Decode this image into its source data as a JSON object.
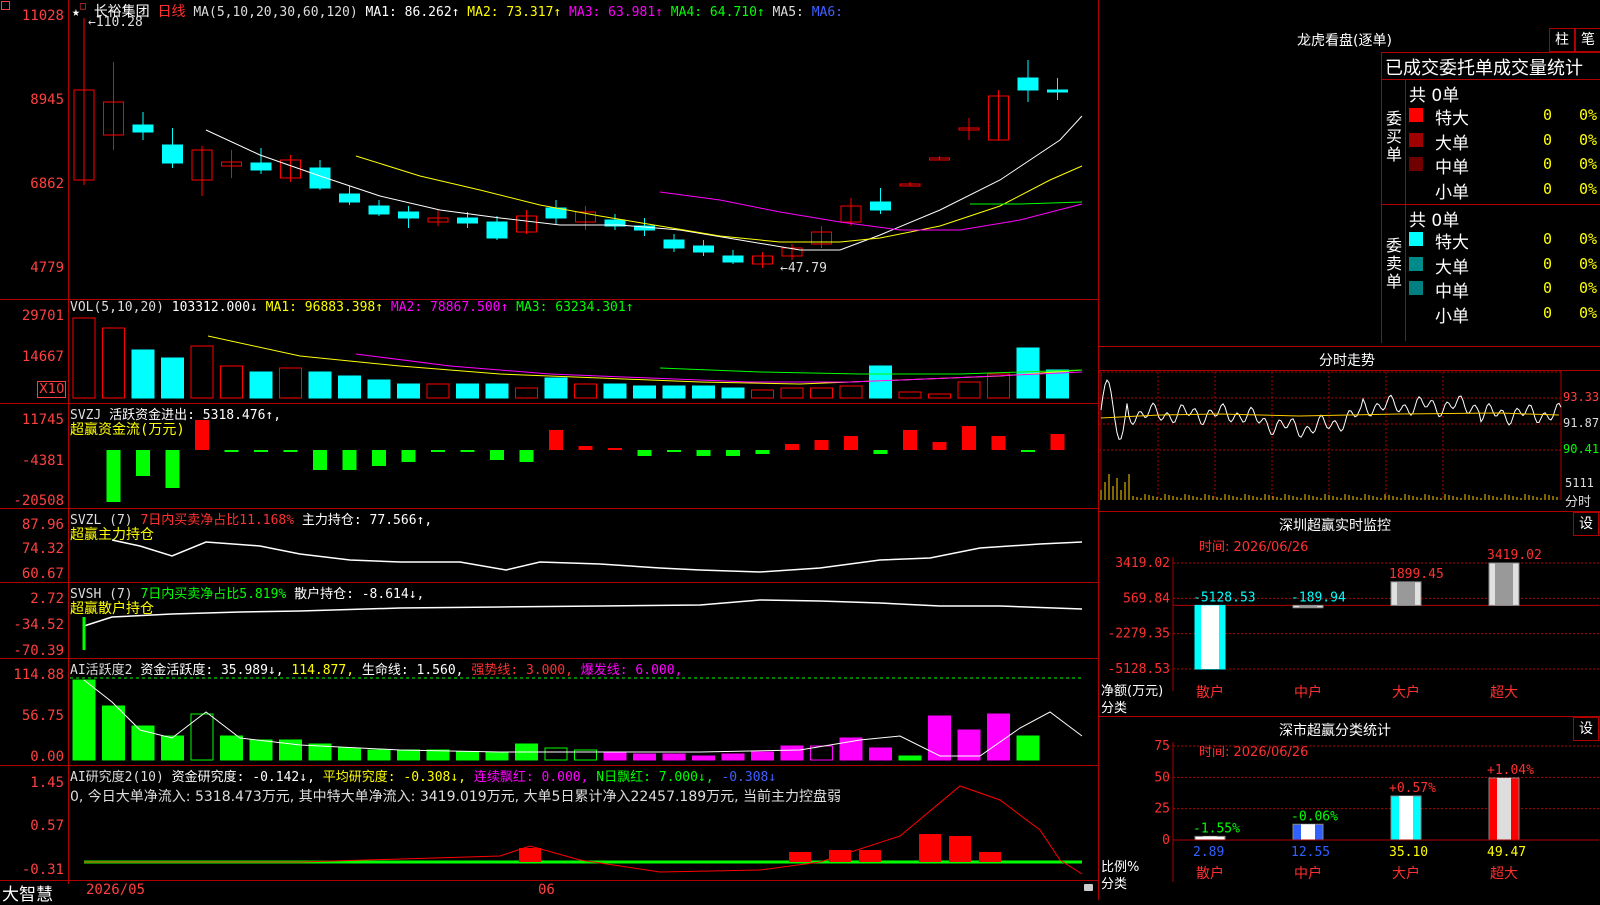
{
  "header": {
    "stock_name": "长裕集团",
    "period": "日线",
    "ma_text": "MA(5,10,20,30,60,120)",
    "ma1": "MA1: 86.262↑",
    "ma2": "MA2: 73.317↑",
    "ma3": "MA3: 63.981↑",
    "ma4": "MA4: 64.710↑",
    "ma5": "MA5:",
    "ma6": "MA6:",
    "high_label": "110.28",
    "low_label": "47.79"
  },
  "price_axis": [
    "11028",
    "8945",
    "6862",
    "4779"
  ],
  "vol": {
    "text": "VOL(5,10,20)",
    "value": "103312.000↓",
    "ma1": "MA1: 96883.398↑",
    "ma2": "MA2: 78867.500↑",
    "ma3": "MA3: 63234.301↑",
    "axis": [
      "29701",
      "14667"
    ],
    "unit": "X10"
  },
  "svzj": {
    "text": "SVZJ",
    "value": "活跃资金进出: 5318.476↑,",
    "sub": "超赢资金流(万元)",
    "axis": [
      "11745",
      "-4381",
      "-20508"
    ]
  },
  "svzl": {
    "text": "SVZL (7)",
    "ratio": "7日内买卖净占比11.168%",
    "value": "主力持仓: 77.566↑,",
    "sub": "超赢主力持仓",
    "axis": [
      "87.96",
      "74.32",
      "60.67"
    ]
  },
  "svsh": {
    "text": "SVSH (7)",
    "ratio": "7日内买卖净占比5.819%",
    "value": "散户持仓: -8.614↓,",
    "sub": "超赢散户持仓",
    "axis": [
      "2.72",
      "-34.52",
      "-70.39"
    ]
  },
  "ai_hyd": {
    "text": "AI活跃度2",
    "v1": "资金活跃度: 35.989↓,",
    "v2": "114.877,",
    "v3": "生命线: 1.560,",
    "v4": "强势线: 3.000,",
    "v5": "爆发线: 6.000,",
    "axis": [
      "114.88",
      "56.75",
      "0.00"
    ]
  },
  "ai_yjd": {
    "text": "AI研究度2(10)",
    "v1": "资金研究度: -0.142↓,",
    "v2": "平均研究度: -0.308↓,",
    "v3": "连续飘红: 0.000,",
    "v4": "N日飘红: 7.000↓,",
    "v5": "-0.308↓",
    "line2": "0, 今日大单净流入: 5318.473万元, 其中特大单净流入: 3419.019万元, 大单5日累计净入22457.189万元, 当前主力控盘弱",
    "axis": [
      "1.45",
      "0.57",
      "-0.31"
    ]
  },
  "footer": {
    "brand": "大智慧",
    "date1": "2026/05",
    "date2": "06"
  },
  "lhb": {
    "title": "龙虎看盘(逐单)",
    "btn1": "柱",
    "btn2": "笔",
    "subtitle": "已成交委托单成交量统计",
    "buy_label": "委买单",
    "sell_label": "委卖单",
    "buy_total": "共 0单",
    "sell_total": "共 0单",
    "buy_rows": [
      {
        "name": "特大",
        "count": "0",
        "pct": "0%",
        "color": "#ff0000"
      },
      {
        "name": "大单",
        "count": "0",
        "pct": "0%",
        "color": "#a00000"
      },
      {
        "name": "中单",
        "count": "0",
        "pct": "0%",
        "color": "#700000"
      },
      {
        "name": "小单",
        "count": "0",
        "pct": "0%",
        "color": ""
      }
    ],
    "sell_rows": [
      {
        "name": "特大",
        "count": "0",
        "pct": "0%",
        "color": "#00ffff"
      },
      {
        "name": "大单",
        "count": "0",
        "pct": "0%",
        "color": "#008b8b"
      },
      {
        "name": "中单",
        "count": "0",
        "pct": "0%",
        "color": "#008080"
      },
      {
        "name": "小单",
        "count": "0",
        "pct": "0%",
        "color": ""
      }
    ]
  },
  "fenshi": {
    "title": "分时走势",
    "axis": [
      "93.33",
      "91.87",
      "90.41"
    ],
    "vol": "5111",
    "label": "分时"
  },
  "monitor": {
    "title": "深圳超赢实时监控",
    "btn": "设",
    "time": "时间: 2026/06/26",
    "axis": [
      "3419.02",
      "569.84",
      "-2279.35",
      "-5128.53"
    ],
    "ylabel": "净额(万元)",
    "xlabel": "分类"
  },
  "classify": {
    "title": "深市超赢分类统计",
    "btn": "设",
    "time": "时间: 2026/06/26",
    "axis": [
      "75",
      "50",
      "25",
      "0"
    ],
    "ylabel": "比例%",
    "xlabel": "分类"
  },
  "colors": {
    "up": "#ff0000",
    "down": "#00ffff",
    "grid": "#b00000",
    "green": "#00ff00",
    "magenta": "#ff00ff",
    "yellow": "#ffff00"
  },
  "chart_data": [
    {
      "type": "bar",
      "title": "深圳超赢实时监控",
      "ylabel": "净额(万元)",
      "xlabel": "分类",
      "categories": [
        "散户",
        "中户",
        "大户",
        "超大"
      ],
      "values": [
        -5128.53,
        -189.94,
        1899.45,
        3419.02
      ],
      "value_labels": [
        "-5128.53",
        "-189.94",
        "1899.45",
        "3419.02"
      ],
      "ylim": [
        -5128.53,
        3419.02
      ]
    },
    {
      "type": "bar",
      "title": "深市超赢分类统计",
      "ylabel": "比例%",
      "xlabel": "分类",
      "categories": [
        "散户",
        "中户",
        "大户",
        "超大"
      ],
      "values": [
        2.89,
        12.55,
        35.1,
        49.47
      ],
      "value_labels": [
        "2.89",
        "12.55",
        "35.10",
        "49.47"
      ],
      "changes": [
        "-1.55%",
        "-0.06%",
        "+0.57%",
        "+1.04%"
      ],
      "ylim": [
        0,
        75
      ]
    }
  ]
}
